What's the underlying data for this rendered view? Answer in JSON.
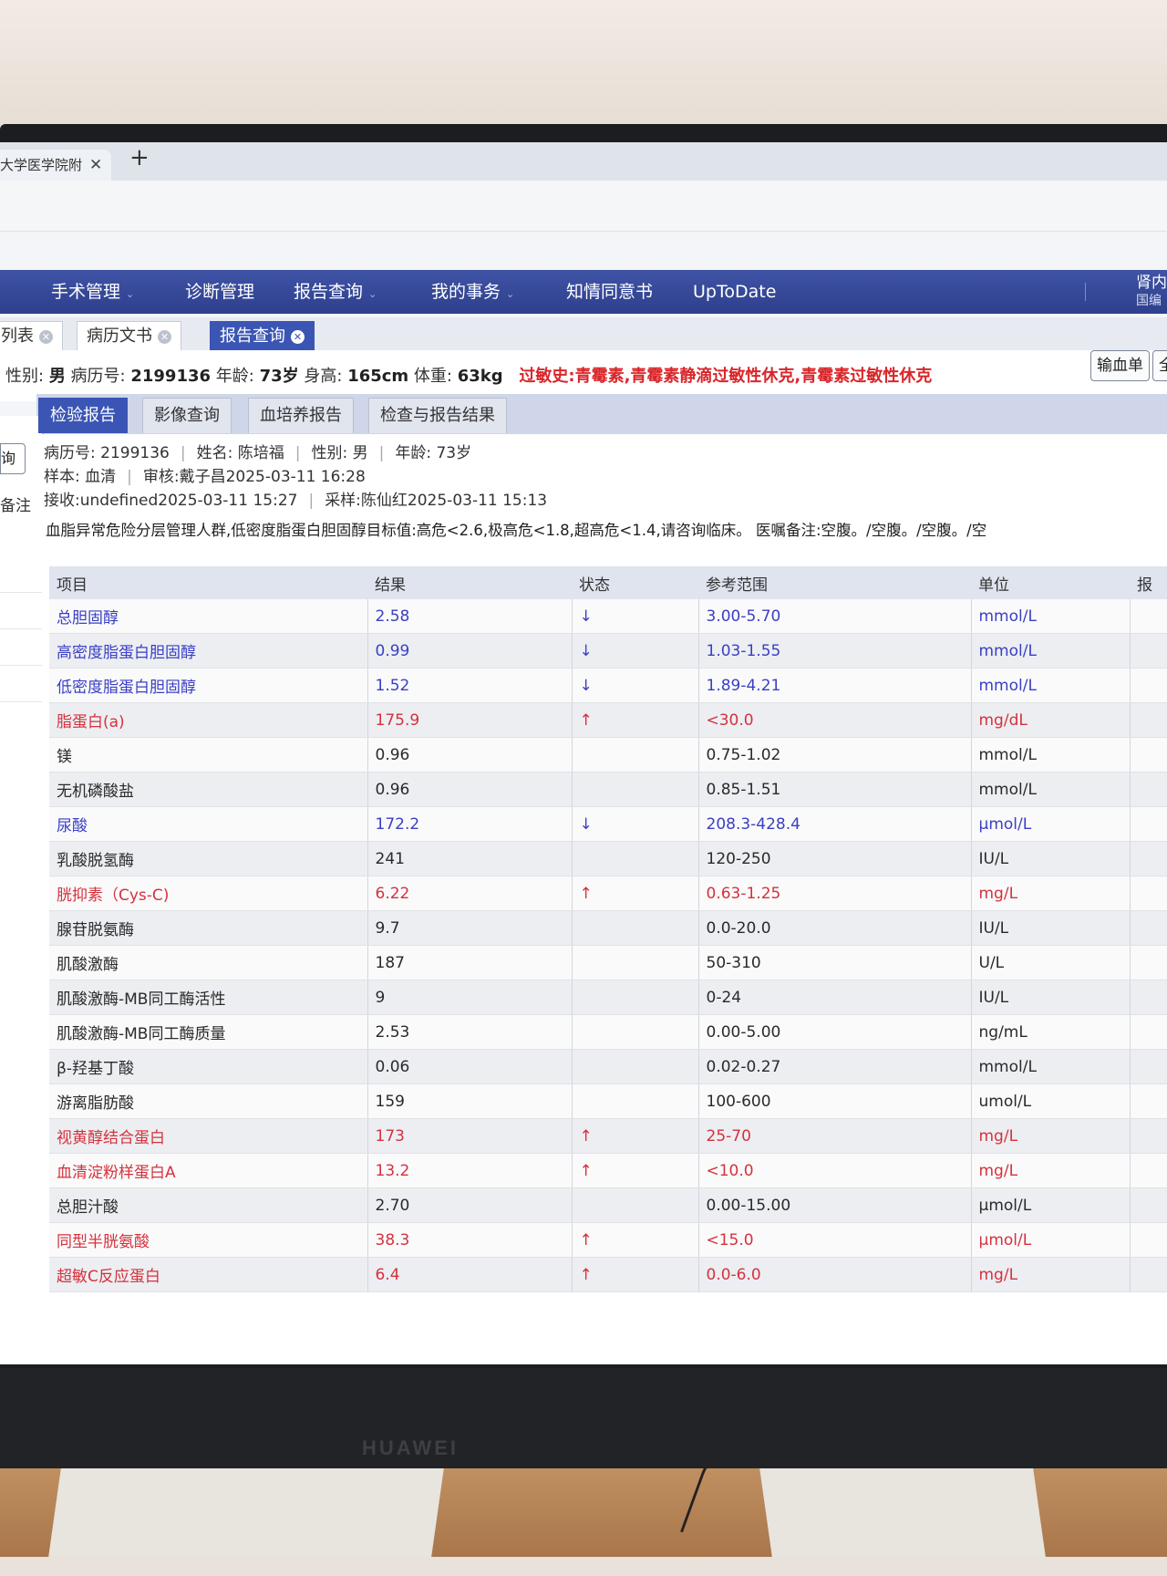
{
  "browser": {
    "tab_title": "大学医学院附",
    "tab_close": "✕",
    "new_tab": "+"
  },
  "nav": {
    "items": [
      {
        "label": "手术管理",
        "caret": "⌄"
      },
      {
        "label": "诊断管理",
        "caret": ""
      },
      {
        "label": "报告查询",
        "caret": "⌄"
      },
      {
        "label": "我的事务",
        "caret": "⌄"
      },
      {
        "label": "知情同意书",
        "caret": ""
      },
      {
        "label": "UpToDate",
        "caret": ""
      }
    ],
    "right_label_1": "肾内",
    "right_label_2": "国编"
  },
  "page_tabs": [
    {
      "label": "列表",
      "close": "✕",
      "active": false
    },
    {
      "label": "病历文书",
      "close": "✕",
      "active": false
    },
    {
      "label": "报告查询",
      "close": "✕",
      "active": true
    }
  ],
  "patient": {
    "sex_label": "性别:",
    "sex": "男",
    "record_label": "病历号:",
    "record_no": "2199136",
    "age_label": "年龄:",
    "age": "73岁",
    "height_label": "身高:",
    "height": "165cm",
    "weight_label": "体重:",
    "weight": "63kg",
    "allergy": "过敏史:青霉素,青霉素静滴过敏性休克,青霉素过敏性休克",
    "btn_transfusion": "输血单",
    "btn_more": "全"
  },
  "sidebar": {
    "btn": "询",
    "label": "备注"
  },
  "report_tabs": [
    {
      "label": "检验报告",
      "active": true
    },
    {
      "label": "影像查询",
      "active": false
    },
    {
      "label": "血培养报告",
      "active": false
    },
    {
      "label": "检查与报告结果",
      "active": false
    }
  ],
  "report_meta": {
    "record": "病历号: 2199136",
    "name": "姓名: 陈培福",
    "sex": "性别: 男",
    "age": "年龄: 73岁",
    "sample": "样本: 血清",
    "review": "审核:戴子昌2025-03-11 16:28",
    "receive": "接收:undefined2025-03-11 15:27",
    "collect": "采样:陈仙红2025-03-11 15:13",
    "note": "血脂异常危险分层管理人群,低密度脂蛋白胆固醇目标值:高危<2.6,极高危<1.8,超高危<1.4,请咨询临床。 医嘱备注:空腹。/空腹。/空腹。/空"
  },
  "table": {
    "headers": [
      "项目",
      "结果",
      "状态",
      "参考范围",
      "单位",
      "报"
    ],
    "rows": [
      {
        "name": "总胆固醇",
        "result": "2.58",
        "status": "↓",
        "range": "3.00-5.70",
        "unit": "mmol/L",
        "flag": "low"
      },
      {
        "name": "高密度脂蛋白胆固醇",
        "result": "0.99",
        "status": "↓",
        "range": "1.03-1.55",
        "unit": "mmol/L",
        "flag": "low"
      },
      {
        "name": "低密度脂蛋白胆固醇",
        "result": "1.52",
        "status": "↓",
        "range": "1.89-4.21",
        "unit": "mmol/L",
        "flag": "low"
      },
      {
        "name": "脂蛋白(a)",
        "result": "175.9",
        "status": "↑",
        "range": "<30.0",
        "unit": "mg/dL",
        "flag": "high"
      },
      {
        "name": "镁",
        "result": "0.96",
        "status": "",
        "range": "0.75-1.02",
        "unit": "mmol/L",
        "flag": "normal"
      },
      {
        "name": "无机磷酸盐",
        "result": "0.96",
        "status": "",
        "range": "0.85-1.51",
        "unit": "mmol/L",
        "flag": "normal"
      },
      {
        "name": "尿酸",
        "result": "172.2",
        "status": "↓",
        "range": "208.3-428.4",
        "unit": "μmol/L",
        "flag": "low"
      },
      {
        "name": "乳酸脱氢酶",
        "result": "241",
        "status": "",
        "range": "120-250",
        "unit": "IU/L",
        "flag": "normal"
      },
      {
        "name": "胱抑素（Cys-C)",
        "result": "6.22",
        "status": "↑",
        "range": "0.63-1.25",
        "unit": "mg/L",
        "flag": "high"
      },
      {
        "name": "腺苷脱氨酶",
        "result": "9.7",
        "status": "",
        "range": "0.0-20.0",
        "unit": "IU/L",
        "flag": "normal"
      },
      {
        "name": "肌酸激酶",
        "result": "187",
        "status": "",
        "range": "50-310",
        "unit": "U/L",
        "flag": "normal"
      },
      {
        "name": "肌酸激酶-MB同工酶活性",
        "result": "9",
        "status": "",
        "range": "0-24",
        "unit": "IU/L",
        "flag": "normal"
      },
      {
        "name": "肌酸激酶-MB同工酶质量",
        "result": "2.53",
        "status": "",
        "range": "0.00-5.00",
        "unit": "ng/mL",
        "flag": "normal"
      },
      {
        "name": "β-羟基丁酸",
        "result": "0.06",
        "status": "",
        "range": "0.02-0.27",
        "unit": "mmol/L",
        "flag": "normal"
      },
      {
        "name": "游离脂肪酸",
        "result": "159",
        "status": "",
        "range": "100-600",
        "unit": "umol/L",
        "flag": "normal"
      },
      {
        "name": "视黄醇结合蛋白",
        "result": "173",
        "status": "↑",
        "range": "25-70",
        "unit": "mg/L",
        "flag": "high"
      },
      {
        "name": "血清淀粉样蛋白A",
        "result": "13.2",
        "status": "↑",
        "range": "<10.0",
        "unit": "mg/L",
        "flag": "high"
      },
      {
        "name": "总胆汁酸",
        "result": "2.70",
        "status": "",
        "range": "0.00-15.00",
        "unit": "μmol/L",
        "flag": "normal"
      },
      {
        "name": "同型半胱氨酸",
        "result": "38.3",
        "status": "↑",
        "range": "<15.0",
        "unit": "μmol/L",
        "flag": "high"
      },
      {
        "name": "超敏C反应蛋白",
        "result": "6.4",
        "status": "↑",
        "range": "0.0-6.0",
        "unit": "mg/L",
        "flag": "high"
      }
    ]
  },
  "monitor": {
    "brand": "HUAWEI"
  },
  "colors": {
    "nav_bg": "#2e3f8c",
    "low_value": "#3a3fc5",
    "high_value": "#d4323c",
    "allergy": "#d9262a"
  }
}
